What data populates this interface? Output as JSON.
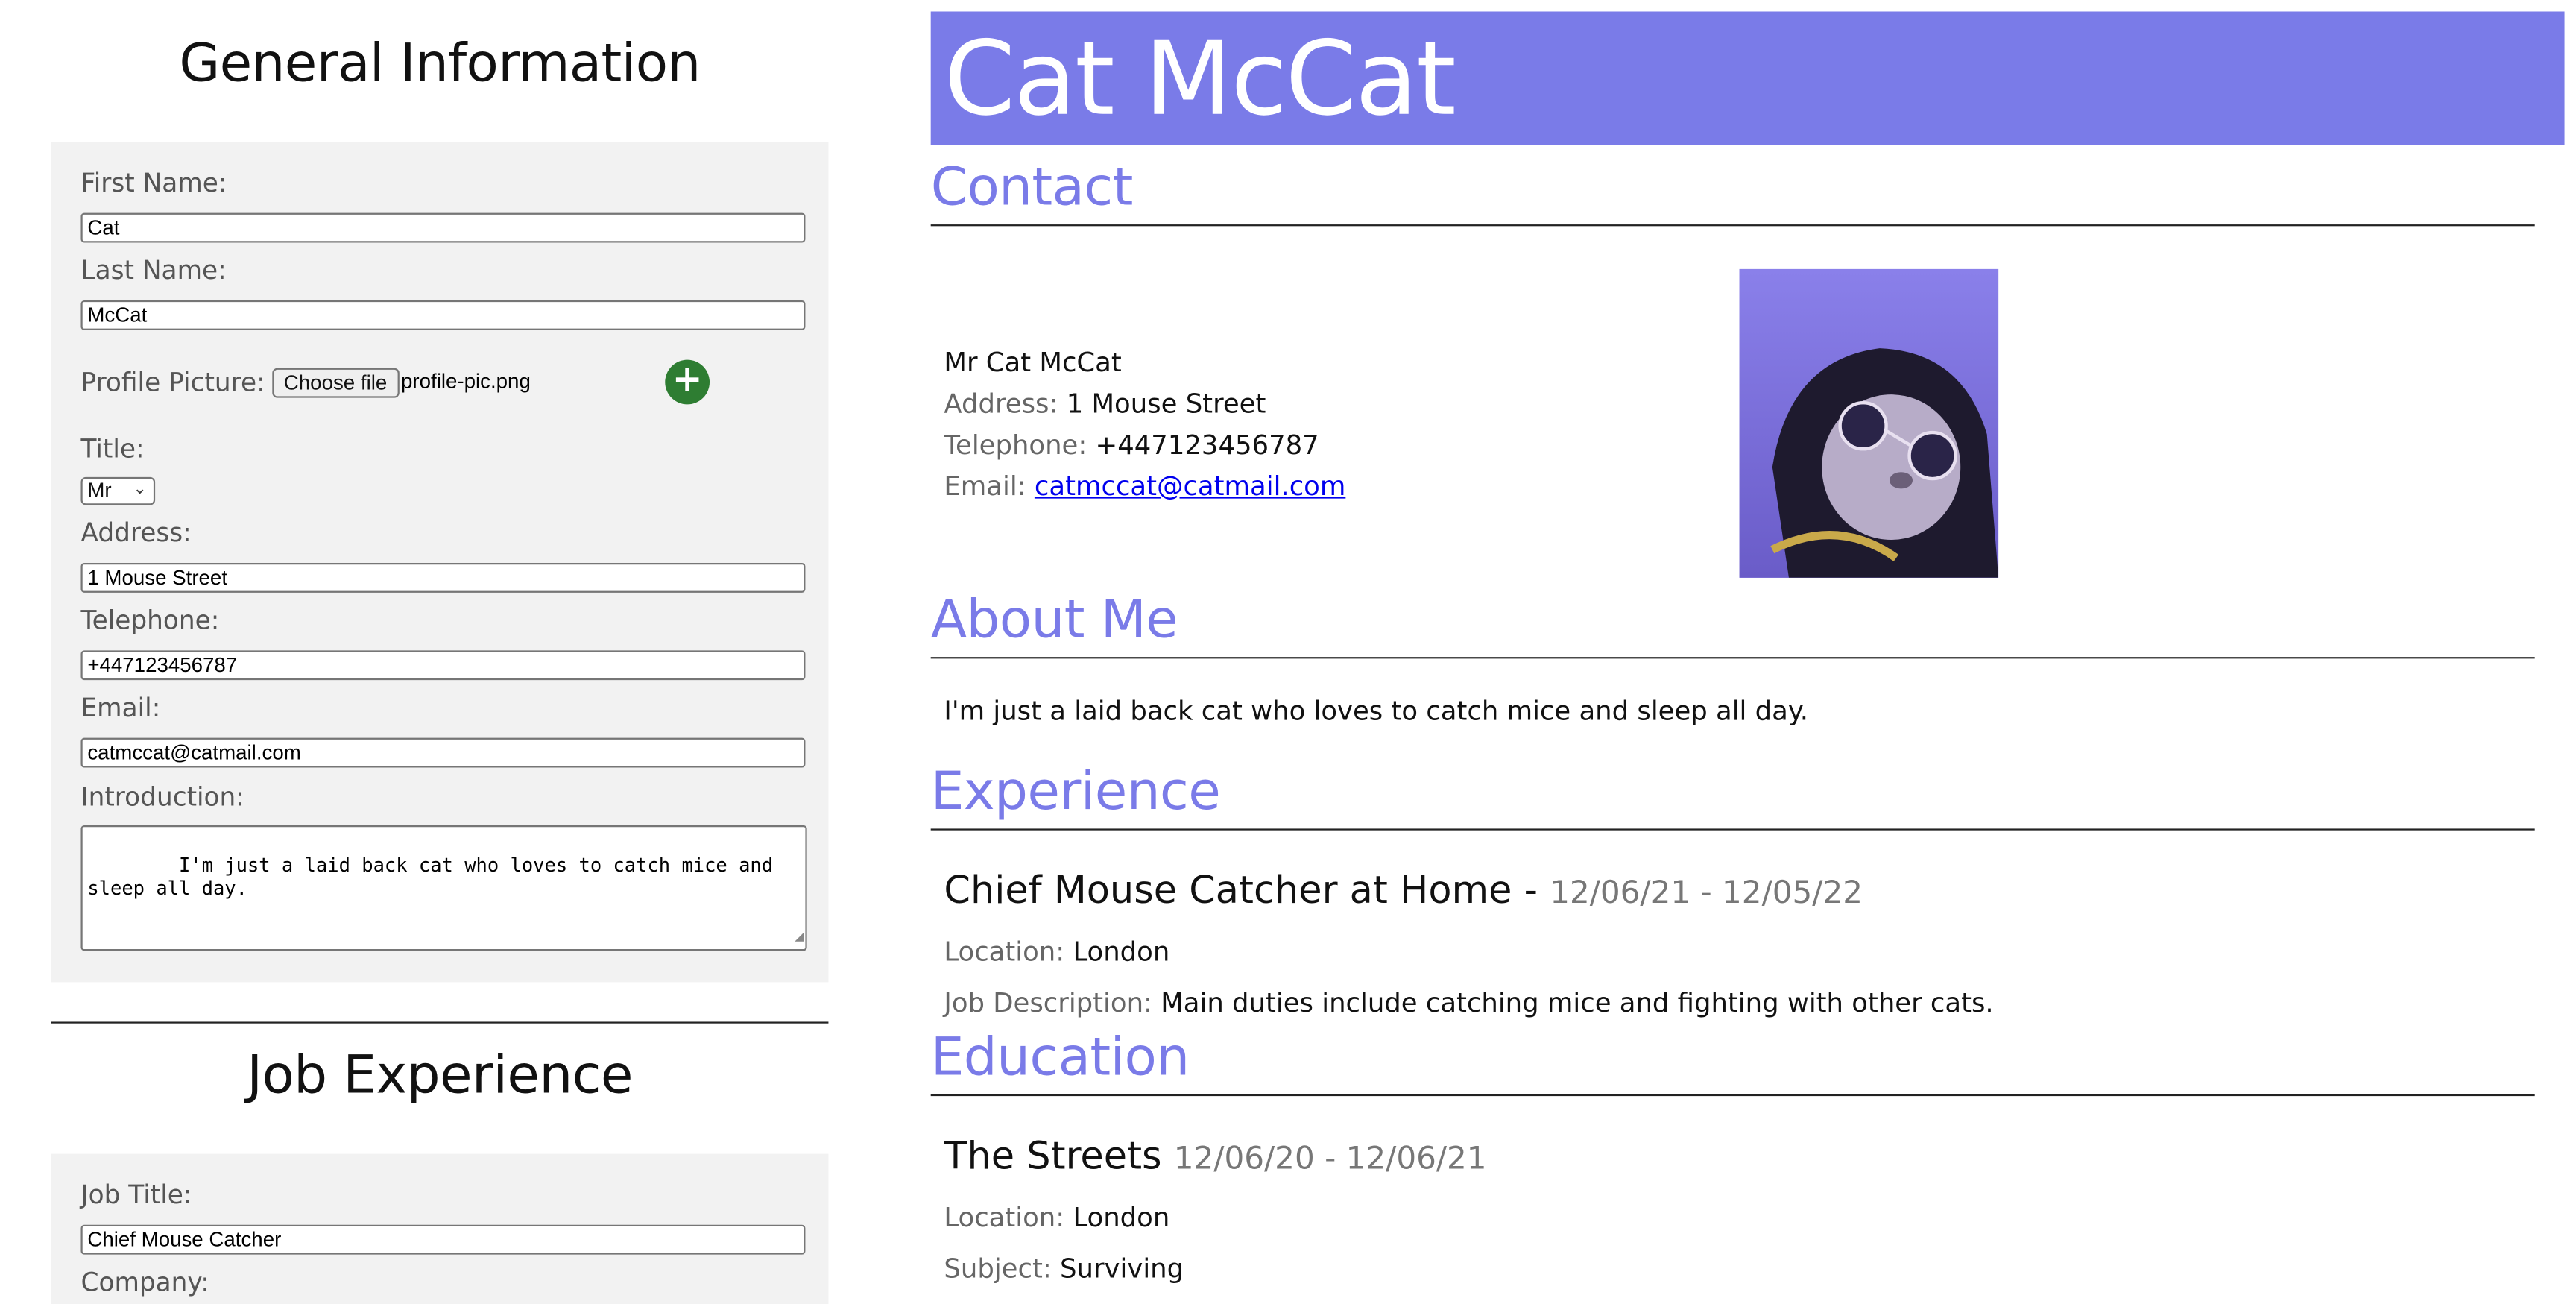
{
  "form": {
    "general_title": "General Information",
    "first_name_label": "First Name:",
    "first_name_value": "Cat",
    "last_name_label": "Last Name:",
    "last_name_value": "McCat",
    "profile_picture_label": "Profile Picture:",
    "choose_file_label": "Choose file",
    "file_name": "profile-pic.png",
    "add_icon": "+",
    "title_label": "Title:",
    "title_value": "Mr",
    "address_label": "Address:",
    "address_value": "1 Mouse Street",
    "telephone_label": "Telephone:",
    "telephone_value": "+447123456787",
    "email_label": "Email:",
    "email_value": "catmccat@catmail.com",
    "intro_label": "Introduction:",
    "intro_value": "I'm just a laid back cat who loves to catch mice and sleep all day.",
    "job_title_heading": "Job Experience",
    "job_title_label": "Job Title:",
    "job_title_value": "Chief Mouse Catcher",
    "company_label": "Company:"
  },
  "cv": {
    "name": "Cat McCat",
    "contact_heading": "Contact",
    "full_name": "Mr Cat McCat",
    "address_label": "Address:",
    "address_value": "1 Mouse Street",
    "telephone_label": "Telephone:",
    "telephone_value": "+447123456787",
    "email_label": "Email:",
    "email_value": "catmccat@catmail.com",
    "about_heading": "About Me",
    "about_text": "I'm just a laid back cat who loves to catch mice and sleep all day.",
    "experience_heading": "Experience",
    "job_heading": "Chief Mouse Catcher at Home -",
    "job_dates": "12/06/21 - 12/05/22",
    "location_label": "Location:",
    "job_location": "London",
    "job_desc_label": "Job Description:",
    "job_desc": "Main duties include catching mice and fighting with other cats.",
    "education_heading": "Education",
    "school": "The Streets",
    "school_dates": "12/06/20 - 12/06/21",
    "edu_location": "London",
    "subject_label": "Subject:",
    "subject": "Surviving"
  },
  "colors": {
    "accent": "#7a7be8",
    "add_button": "#2e7d32",
    "panel": "#f2f2f2"
  }
}
